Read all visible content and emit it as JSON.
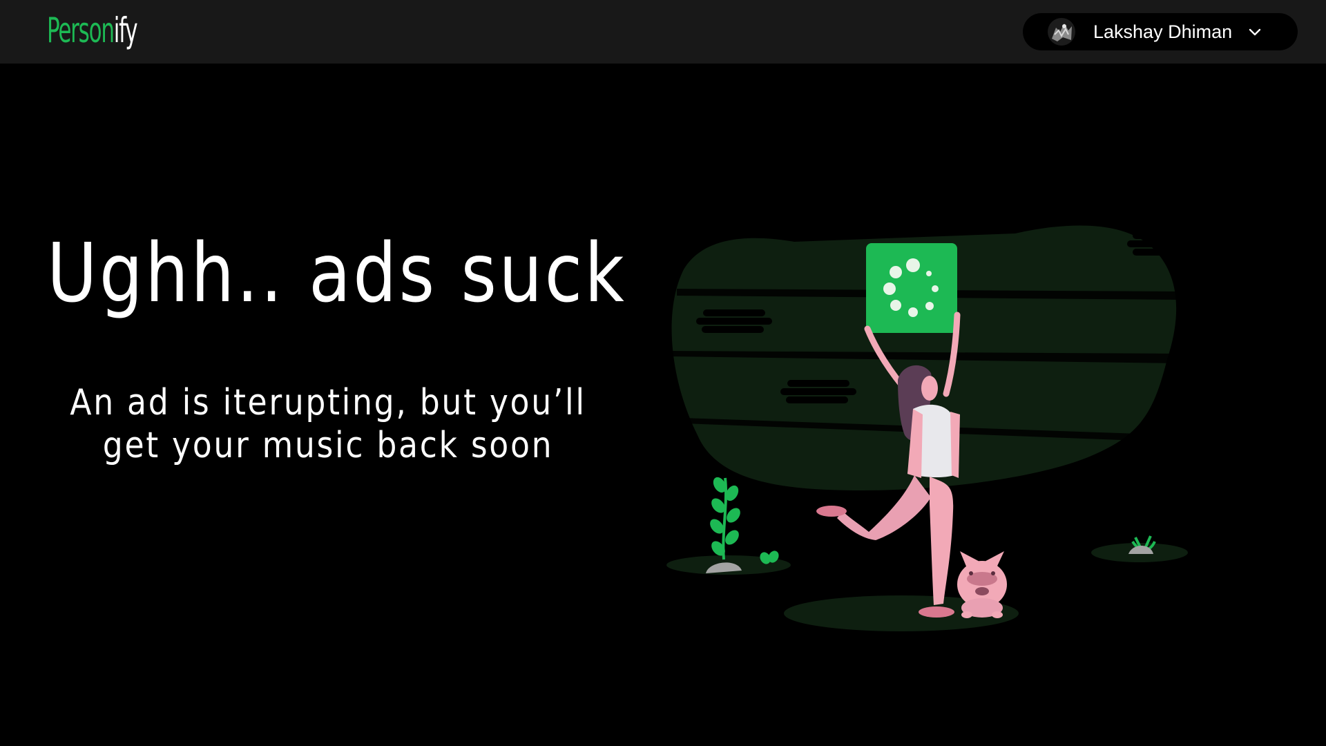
{
  "header": {
    "logo_part1": "Person",
    "logo_part2": "ify",
    "user_name": "Lakshay Dhiman"
  },
  "main": {
    "headline": "Ughh.. ads suck",
    "subtext": "An ad is iterupting, but you’ll get your music back soon"
  },
  "colors": {
    "accent": "#1db954",
    "background": "#000000",
    "topbar": "#181818",
    "blob": "#0e1f10",
    "figure_pink": "#f2a9b7"
  },
  "icons": {
    "avatar": "avatar-image",
    "dropdown": "chevron-down-icon",
    "loading": "loading-spinner-icon"
  }
}
